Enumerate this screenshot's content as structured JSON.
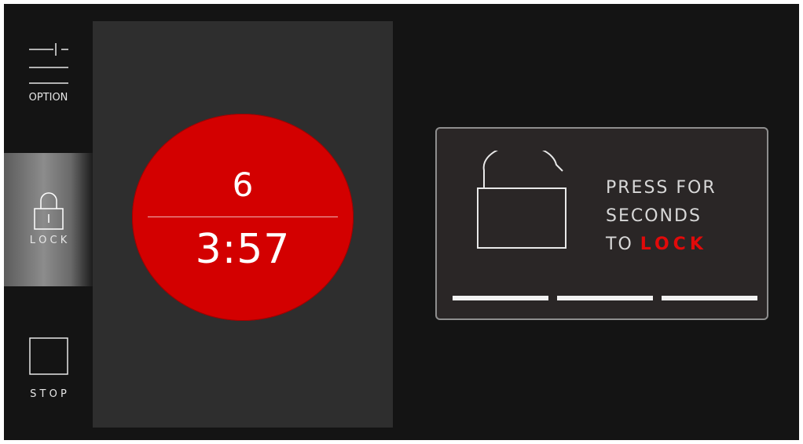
{
  "sidebar": {
    "option": {
      "label": "OPTION",
      "icon": "option-sliders-icon"
    },
    "lock": {
      "label": "L O C K",
      "icon": "padlock-icon",
      "active": true
    },
    "stop": {
      "label": "S T O P",
      "icon": "stop-square-icon"
    }
  },
  "timer": {
    "level": "6",
    "time": "3:57",
    "color": "#d30000"
  },
  "lock_prompt": {
    "line1": "PRESS FOR",
    "line2": "SECONDS",
    "line3_prefix": "TO ",
    "line3_highlight": "LOCK",
    "highlight_color": "#e10a0a",
    "icon": "unlocked-padlock-icon",
    "progress_segments": 3,
    "progress_filled": 3
  },
  "colors": {
    "background": "#141414",
    "panel": "#2e2e2e",
    "accent": "#d30000"
  }
}
